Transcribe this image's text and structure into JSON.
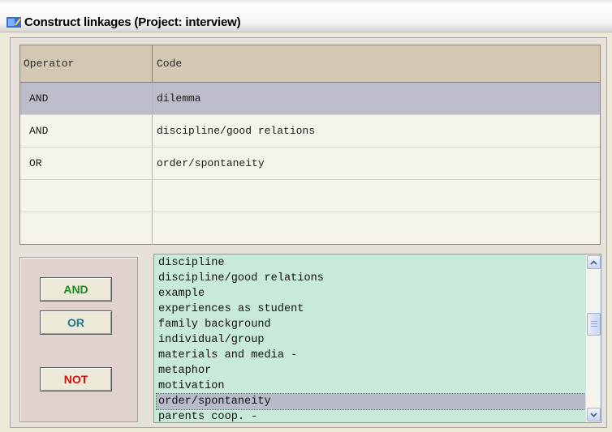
{
  "window": {
    "title": "Construct linkages (Project: interview)"
  },
  "grid": {
    "headers": {
      "operator": "Operator",
      "code": "Code"
    },
    "rows": [
      {
        "operator": "AND",
        "code": "dilemma",
        "selected": true
      },
      {
        "operator": "AND",
        "code": "discipline/good relations",
        "selected": false
      },
      {
        "operator": "OR",
        "code": "order/spontaneity",
        "selected": false
      },
      {
        "operator": "",
        "code": "",
        "selected": false
      },
      {
        "operator": "",
        "code": "",
        "selected": false
      }
    ]
  },
  "buttons": {
    "and": {
      "label": "AND",
      "color": "#1f8a1f"
    },
    "or": {
      "label": "OR",
      "color": "#1f7a8a"
    },
    "not": {
      "label": "NOT",
      "color": "#d01010"
    }
  },
  "code_list": {
    "items": [
      "discipline",
      "discipline/good relations",
      "example",
      "experiences as student",
      "family background",
      "individual/group",
      "materials and media -",
      "metaphor",
      "motivation",
      "order/spontaneity",
      "parents coop. -"
    ],
    "selected_item": "order/spontaneity"
  },
  "colors": {
    "header_bg": "#d4c8b2",
    "selected_row_bg": "#bbbdcb",
    "list_bg": "#c8ead8"
  },
  "icons": {
    "app": "app-icon",
    "scroll_up": "chevron-up-icon",
    "scroll_down": "chevron-down-icon"
  }
}
